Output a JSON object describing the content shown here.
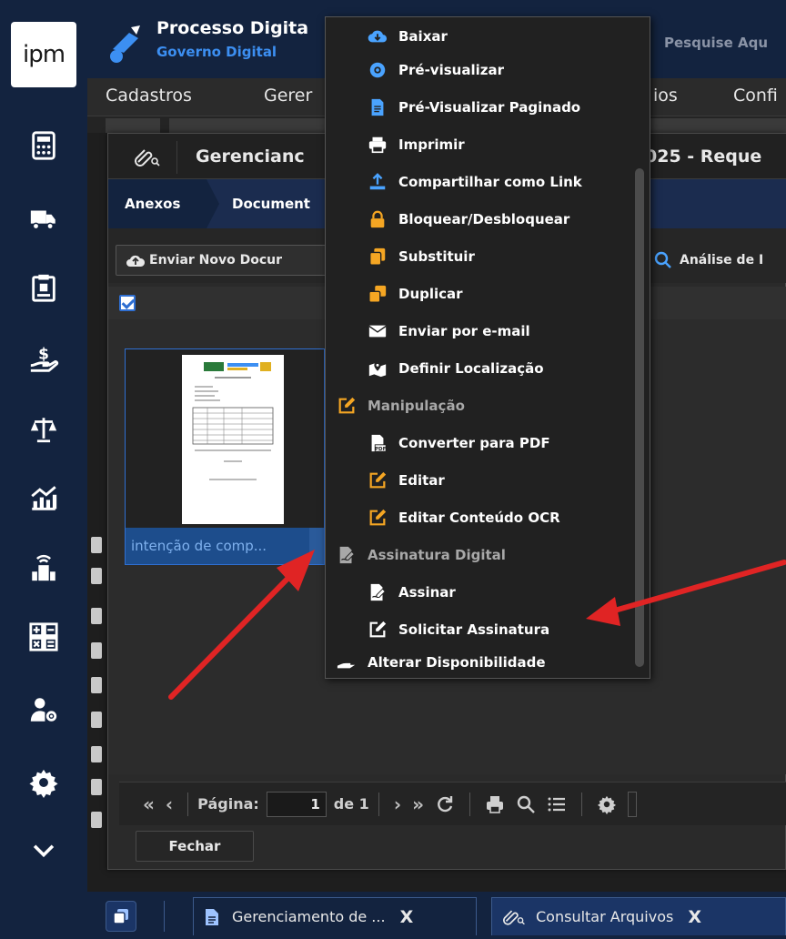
{
  "sidebar": {
    "logo_text": "ipm",
    "icons": [
      "calculator-icon",
      "truck-icon",
      "clipboard-icon",
      "hand-money-icon",
      "scales-icon",
      "chart-growth-icon",
      "building-wifi-icon",
      "math-ops-icon",
      "user-settings-icon",
      "gear-icon",
      "chevron-down-icon"
    ]
  },
  "header": {
    "title": "Processo Digita",
    "subtitle": "Governo Digital",
    "search_placeholder": "Pesquise Aqu",
    "menu": [
      "Cadastros",
      "Gerer",
      "ios",
      "Confi"
    ]
  },
  "dialog": {
    "title_left": "Gerencianc",
    "title_right": "025 - Reque",
    "tabs": [
      "Anexos",
      "Document"
    ],
    "upload_label": "Enviar Novo Docur",
    "analise_label": "Análise de I",
    "document": {
      "caption": "intenção de comp..."
    },
    "pager": {
      "page_label": "Página:",
      "page_value": "1",
      "of_label": "de 1"
    },
    "close_label": "Fechar"
  },
  "context_menu": {
    "items": [
      {
        "label": "Baixar",
        "icon": "cloud-download-icon",
        "color": "#4aa3ff"
      },
      {
        "label": "Pré-visualizar",
        "icon": "eye-icon",
        "color": "#4aa3ff"
      },
      {
        "label": "Pré-Visualizar Paginado",
        "icon": "document-icon",
        "color": "#4aa3ff"
      },
      {
        "label": "Imprimir",
        "icon": "printer-icon",
        "color": "#ffffff"
      },
      {
        "label": "Compartilhar como Link",
        "icon": "share-upload-icon",
        "color": "#4aa3ff"
      },
      {
        "label": "Bloquear/Desbloquear",
        "icon": "lock-icon",
        "color": "#f5a623"
      },
      {
        "label": "Substituir",
        "icon": "copy-icon",
        "color": "#f5a623"
      },
      {
        "label": "Duplicar",
        "icon": "duplicate-icon",
        "color": "#f5a623"
      },
      {
        "label": "Enviar por e-mail",
        "icon": "envelope-icon",
        "color": "#ffffff"
      },
      {
        "label": "Definir Localização",
        "icon": "map-pin-icon",
        "color": "#ffffff"
      },
      {
        "label": "Manipulação",
        "icon": "edit-icon",
        "color": "#f5a623",
        "group": true
      },
      {
        "label": "Converter para PDF",
        "icon": "pdf-icon",
        "color": "#ffffff"
      },
      {
        "label": "Editar",
        "icon": "edit-icon",
        "color": "#f5a623"
      },
      {
        "label": "Editar Conteúdo OCR",
        "icon": "edit-icon",
        "color": "#f5a623"
      },
      {
        "label": "Assinatura Digital",
        "icon": "signature-icon",
        "color": "#a8a8a8",
        "group": true
      },
      {
        "label": "Assinar",
        "icon": "signature-icon",
        "color": "#ffffff"
      },
      {
        "label": "Solicitar Assinatura",
        "icon": "edit-icon",
        "color": "#ffffff"
      },
      {
        "label": "Alterar Disponibilidade",
        "icon": "hand-icon",
        "color": "#ffffff"
      }
    ]
  },
  "taskbar": {
    "tabs": [
      {
        "label": "Gerenciamento de ...",
        "close": "X"
      },
      {
        "label": "Consultar Arquivos",
        "close": "X"
      }
    ]
  },
  "annotation_color": "#e02424"
}
